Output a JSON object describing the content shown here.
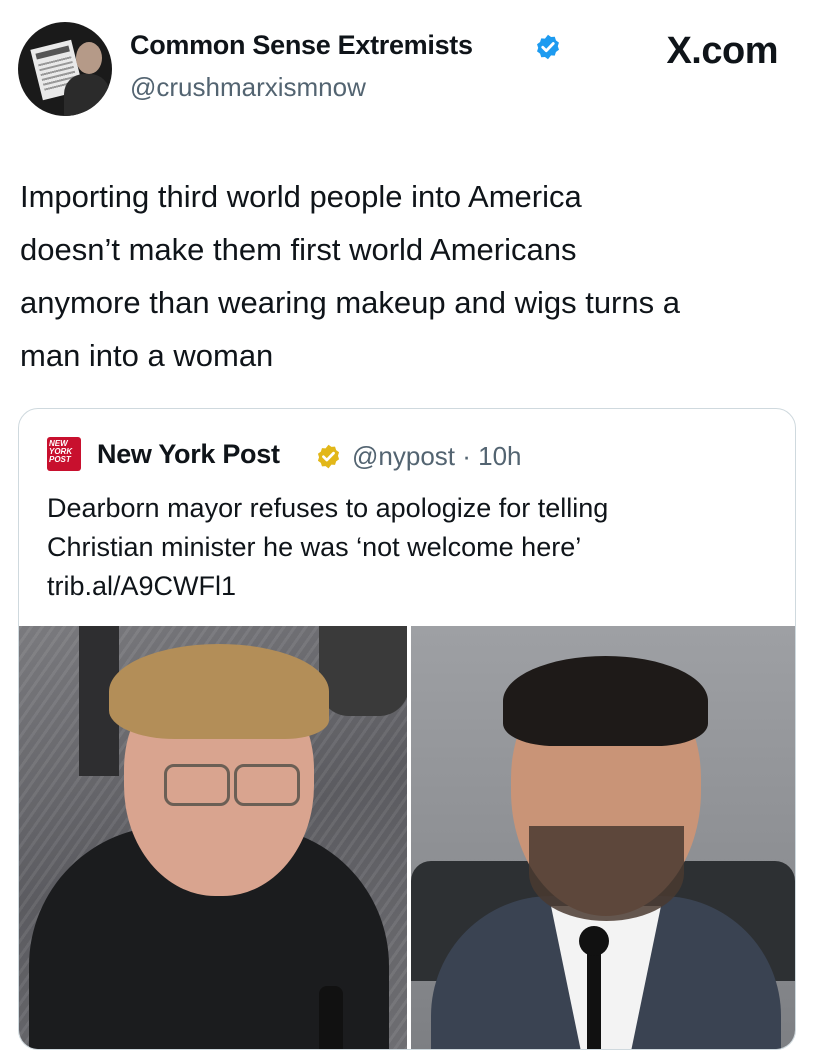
{
  "author": {
    "name": "Common Sense Extremists",
    "handle": "@crushmarxismnow",
    "verified_color": "#1d9bf0"
  },
  "brand": "X.com",
  "tweet": {
    "lines": [
      "Importing third world people into America",
      "doesn’t make them first world Americans",
      "anymore than wearing makeup and wigs turns a",
      "man into a woman"
    ]
  },
  "quoted": {
    "logo_text": [
      "NEW",
      "YORK",
      "POST"
    ],
    "name": "New York Post",
    "verified_color": "#e2b719",
    "handle_time": "@nypost · 10h",
    "lines": [
      "Dearborn mayor refuses to apologize for telling",
      "Christian minister he was ‘not welcome here’",
      "trib.al/A9CWFl1"
    ]
  },
  "colors": {
    "text": "#0f1419",
    "secondary": "#536471",
    "border": "#cfd9de",
    "nyp_red": "#c8102e"
  }
}
